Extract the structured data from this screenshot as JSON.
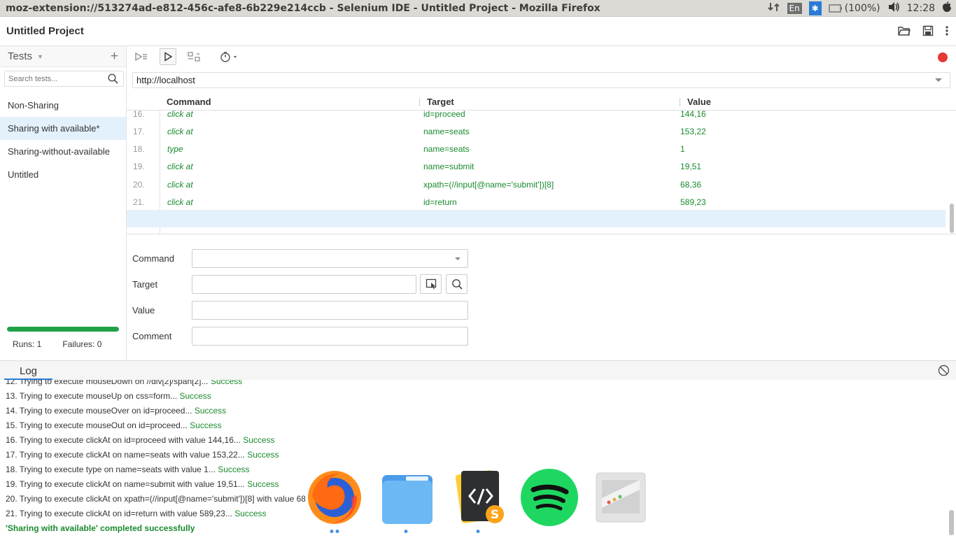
{
  "os": {
    "window_title": "moz-extension://513274ad-e812-456c-afe8-6b229e214ccb - Selenium IDE - Untitled Project - Mozilla Firefox",
    "keyboard_layout": "En",
    "battery": "(100%)",
    "clock": "12:28"
  },
  "header": {
    "project_title": "Untitled Project"
  },
  "sidebar": {
    "tests_label": "Tests",
    "search_placeholder": "Search tests...",
    "tests": [
      {
        "label": "Non-Sharing"
      },
      {
        "label": "Sharing with available*",
        "active": true
      },
      {
        "label": "Sharing-without-available"
      },
      {
        "label": "Untitled"
      }
    ],
    "progress": 1.0,
    "progress_color": "#22a046",
    "runs": "Runs: 1",
    "failures": "Failures: 0"
  },
  "main": {
    "url": "http://localhost",
    "columns": {
      "command": "Command",
      "target": "Target",
      "value": "Value"
    },
    "rows": [
      {
        "num": "16.",
        "command": "click at",
        "target": "id=proceed",
        "value": "144,16"
      },
      {
        "num": "17.",
        "command": "click at",
        "target": "name=seats",
        "value": "153,22"
      },
      {
        "num": "18.",
        "command": "type",
        "target": "name=seats",
        "value": "1"
      },
      {
        "num": "19.",
        "command": "click at",
        "target": "name=submit",
        "value": "19,51"
      },
      {
        "num": "20.",
        "command": "click at",
        "target": "xpath=(//input[@name='submit'])[8]",
        "value": "68,36"
      },
      {
        "num": "21.",
        "command": "click at",
        "target": "id=return",
        "value": "589,23"
      }
    ],
    "editor": {
      "command_label": "Command",
      "target_label": "Target",
      "value_label": "Value",
      "comment_label": "Comment"
    }
  },
  "log": {
    "tab_label": "Log",
    "lines": [
      {
        "text": "12. Trying to execute mouseDown on //div[2]/span[2]... ",
        "status": "Success"
      },
      {
        "text": "13. Trying to execute mouseUp on css=form... ",
        "status": "Success"
      },
      {
        "text": "14. Trying to execute mouseOver on id=proceed... ",
        "status": "Success"
      },
      {
        "text": "15. Trying to execute mouseOut on id=proceed... ",
        "status": "Success"
      },
      {
        "text": "16. Trying to execute clickAt on id=proceed with value 144,16... ",
        "status": "Success"
      },
      {
        "text": "17. Trying to execute clickAt on name=seats with value 153,22... ",
        "status": "Success"
      },
      {
        "text": "18. Trying to execute type on name=seats with value 1... ",
        "status": "Success"
      },
      {
        "text": "19. Trying to execute clickAt on name=submit with value 19,51... ",
        "status": "Success"
      },
      {
        "text": "20. Trying to execute clickAt on xpath=(//input[@name='submit'])[8] with value 68",
        "status": ""
      },
      {
        "text": "21. Trying to execute clickAt on id=return with value 589,23... ",
        "status": "Success"
      }
    ],
    "completed": "'Sharing with available' completed successfully",
    "success_color": "#1a8a2e"
  },
  "dock": {
    "apps": [
      "firefox-icon",
      "files-icon",
      "sublime-text-icon",
      "spotify-icon",
      "window-switcher-icon"
    ]
  }
}
